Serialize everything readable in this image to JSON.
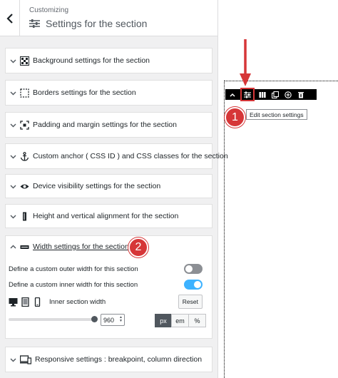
{
  "header": {
    "crumb": "Customizing",
    "title": "Settings for the section"
  },
  "sections": [
    {
      "label": "Background settings for the section",
      "icon": "checkerboard-icon"
    },
    {
      "label": "Borders settings for the section",
      "icon": "dashed-border-icon"
    },
    {
      "label": "Padding and margin settings for the section",
      "icon": "padding-icon"
    },
    {
      "label": "Custom anchor ( CSS ID ) and CSS classes for the section",
      "icon": "anchor-icon"
    },
    {
      "label": "Device visibility settings for the section",
      "icon": "eye-icon"
    },
    {
      "label": "Height and vertical alignment for the section",
      "icon": "height-icon"
    }
  ],
  "width_section": {
    "label": "Width settings for the section",
    "icon": "width-icon",
    "badge": "2",
    "outer_label": "Define a custom outer width for this section",
    "outer_on": false,
    "inner_label": "Define a custom inner width for this section",
    "inner_on": true,
    "inner_width_label": "Inner section width",
    "reset_label": "Reset",
    "value": "960",
    "units": [
      "px",
      "em",
      "%"
    ],
    "active_unit": "px"
  },
  "responsive": {
    "label": "Responsive settings : breakpoint, column direction",
    "icon": "responsive-icon"
  },
  "preview": {
    "badge": "1",
    "tooltip": "Edit section settings",
    "toolbar_icons": [
      "chevron-up-icon",
      "sliders-icon",
      "columns-icon",
      "duplicate-icon",
      "add-circle-icon",
      "trash-icon"
    ]
  },
  "colors": {
    "accent_red": "#d63638",
    "toggle_on": "#3db2ff",
    "toggle_off": "#8c8f94"
  }
}
